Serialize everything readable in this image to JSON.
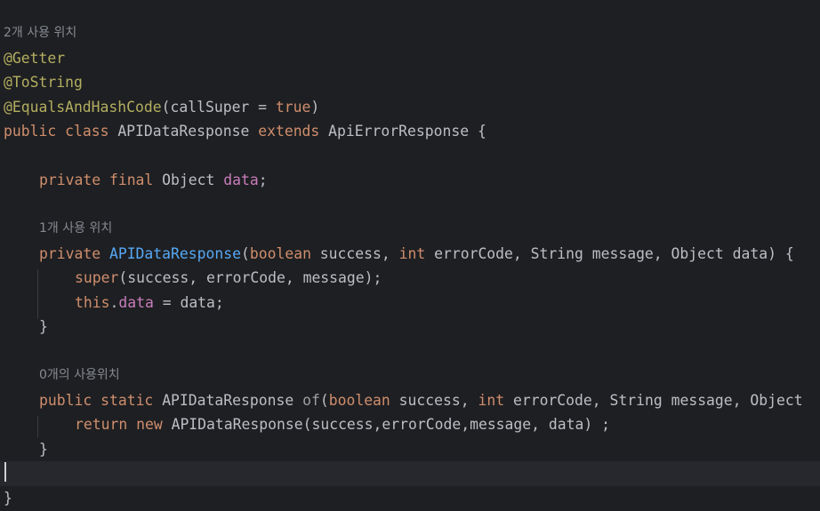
{
  "editor": {
    "hint_class": "2개 사용 위치",
    "ann_getter": "@Getter",
    "ann_tostring": "@ToString",
    "ann_equals": "@EqualsAndHashCode",
    "ann_equals_args_open": "(callSuper = ",
    "ann_equals_true": "true",
    "ann_equals_close": ")",
    "class_kw_public": "public",
    "class_kw_class": "class",
    "class_name": "APIDataResponse",
    "class_kw_extends": "extends",
    "class_super": "ApiErrorResponse",
    "class_open": "{",
    "field_kw_private": "private",
    "field_kw_final": "final",
    "field_type": "Object",
    "field_name": "data",
    "field_semicolon": ";",
    "hint_ctor": "1개 사용 위치",
    "ctor_kw_private": "private",
    "ctor_name": "APIDataResponse",
    "ctor_paren": "(",
    "ctor_kw_boolean": "boolean",
    "ctor_p1": " success, ",
    "ctor_kw_int": "int",
    "ctor_p2": " errorCode, String message, Object data) {",
    "super_kw": "super",
    "super_args": "(success, errorCode, message);",
    "this_kw": "this",
    "this_dot": ".",
    "this_field": "data",
    "this_rest": " = data;",
    "close_brace": "}",
    "hint_of": "0개의 사용위치",
    "of_kw_public": "public",
    "of_kw_static": "static",
    "of_type": "APIDataResponse",
    "of_name": "of",
    "of_paren": "(",
    "of_kw_boolean": "boolean",
    "of_p1": " success, ",
    "of_kw_int": "int",
    "of_p2": " errorCode, String message, Object",
    "ret_kw_return": "return",
    "ret_kw_new": "new",
    "ret_rest": " APIDataResponse(success,errorCode,message, data) ;",
    "method_close": "}",
    "class_close": "}"
  }
}
